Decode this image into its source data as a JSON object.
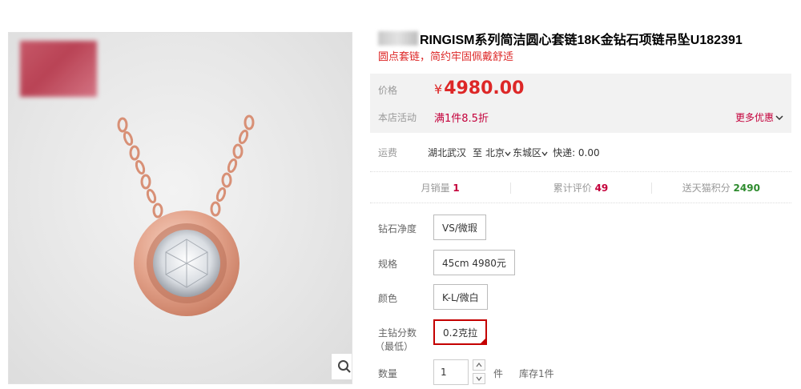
{
  "product": {
    "title": "RINGISM系列简洁圆心套链18K金钻石项链吊坠U182391",
    "subtitle": "圆点套链，简约牢固佩戴舒适"
  },
  "price": {
    "label": "价格",
    "currency": "¥",
    "value": "4980.00",
    "promo_label": "本店活动",
    "promo_value": "满1件8.5折",
    "more_offers": "更多优惠"
  },
  "shipping": {
    "label": "运费",
    "from": "湖北武汉",
    "to_prefix": "至",
    "city": "北京",
    "district": "东城区",
    "express": "快递: 0.00"
  },
  "stats": [
    {
      "label": "月销量",
      "value": "1"
    },
    {
      "label": "累计评价",
      "value": "49"
    },
    {
      "label": "送天猫积分",
      "value": "2490"
    }
  ],
  "sku": {
    "clarity_label": "钻石净度",
    "clarity_value": "VS/微瑕",
    "spec_label": "规格",
    "spec_value": "45cm 4980元",
    "color_label": "颜色",
    "color_value": "K-L/微白",
    "carat_label_line1": "主钻分数",
    "carat_label_line2": "（最低）",
    "carat_value": "0.2克拉"
  },
  "quantity": {
    "label": "数量",
    "value": "1",
    "unit": "件",
    "stock": "库存1件"
  },
  "colors": {
    "accent": "#dd2727",
    "promo": "#c4003b",
    "points": "#2e8b2e",
    "rose_gold": "#e0a18a"
  },
  "icons": {
    "zoom": "search-icon",
    "more_offers": "chevron-down-icon"
  }
}
